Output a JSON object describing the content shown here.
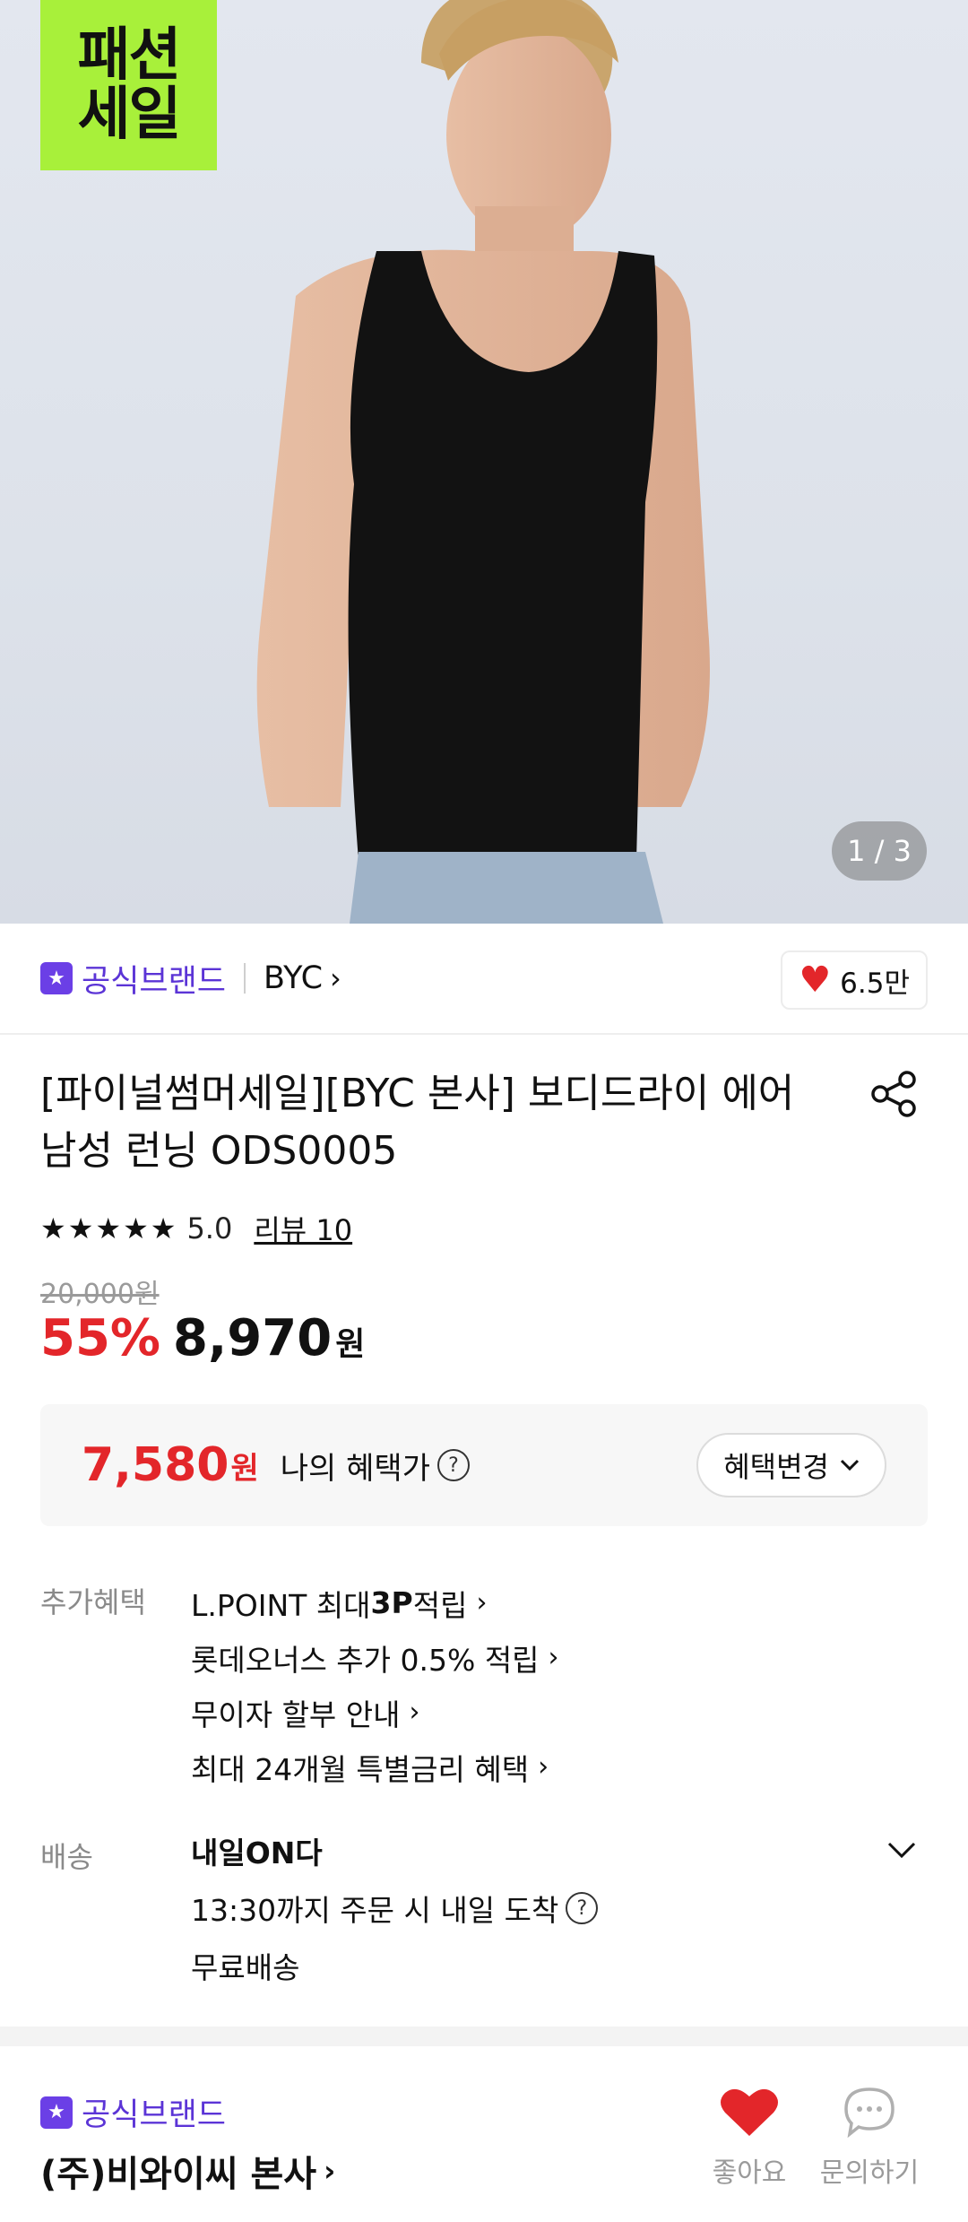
{
  "gallery": {
    "badge_line1": "패션",
    "badge_line2": "세일",
    "page_counter": "1 / 3",
    "current_page": 1,
    "total_pages": 3
  },
  "brand": {
    "official_label": "공식브랜드",
    "name": "BYC",
    "like_count": "6.5만"
  },
  "product": {
    "title_line1": "[파이널썸머세일][BYC 본사] 보디드라이 에어",
    "title_line2": "남성 런닝 ODS0005",
    "stars": "★★★★★",
    "rating": "5.0",
    "review_link": "리뷰 10",
    "original_price": "20,000원",
    "discount_rate": "55%",
    "price": "8,970",
    "currency": "원"
  },
  "benefit": {
    "price": "7,580",
    "currency": "원",
    "label": "나의 혜택가",
    "change_button": "혜택변경"
  },
  "extra_benefits": {
    "label": "추가혜택",
    "items": [
      {
        "pre": "L.POINT 최대 ",
        "bold": "3P",
        "post": " 적립"
      },
      {
        "pre": "롯데오너스 추가 0.5% 적립",
        "bold": "",
        "post": ""
      },
      {
        "pre": "무이자 할부 안내",
        "bold": "",
        "post": ""
      },
      {
        "pre": "최대 24개월 특별금리 혜택",
        "bold": "",
        "post": ""
      }
    ]
  },
  "shipping": {
    "label": "배송",
    "title": "내일ON다",
    "line1": "13:30까지 주문 시 내일 도착",
    "line2": "무료배송"
  },
  "store": {
    "official_label": "공식브랜드",
    "name": "(주)비와이씨 본사",
    "like_label": "좋아요",
    "inquiry_label": "문의하기"
  },
  "colors": {
    "accent_red": "#e3262a",
    "brand_purple": "#5b34d6",
    "badge_green": "#a8f03a"
  }
}
